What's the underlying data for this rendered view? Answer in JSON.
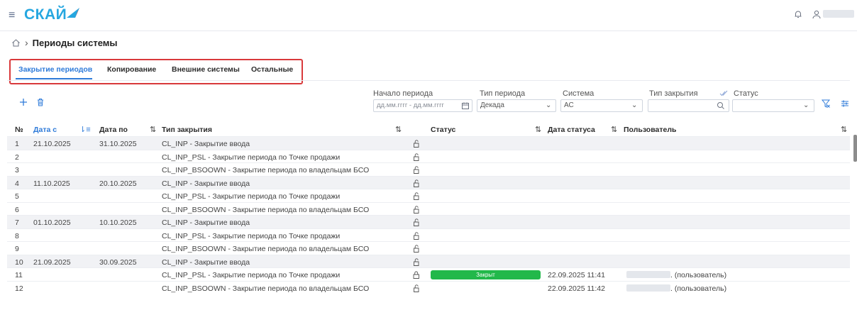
{
  "app": {
    "logo_text": "СКАЙ"
  },
  "breadcrumb": {
    "title": "Периоды системы"
  },
  "tabs": [
    {
      "label": "Закрытие периодов"
    },
    {
      "label": "Копирование"
    },
    {
      "label": "Внешние системы"
    },
    {
      "label": "Остальные"
    }
  ],
  "filters": {
    "period_start": {
      "label": "Начало периода",
      "placeholder": "дд.мм.гггг - дд.мм.гггг"
    },
    "period_type": {
      "label": "Тип периода",
      "value": "Декада"
    },
    "system": {
      "label": "Система",
      "value": "АС"
    },
    "closing_type": {
      "label": "Тип закрытия",
      "value": ""
    },
    "status": {
      "label": "Статус",
      "value": ""
    }
  },
  "table": {
    "columns": {
      "num": "№",
      "date_from": "Дата с",
      "date_to": "Дата по",
      "closing_type": "Тип закрытия",
      "status": "Статус",
      "status_date": "Дата статуса",
      "user": "Пользователь"
    },
    "rows": [
      {
        "num": "1",
        "date_from": "21.10.2025",
        "date_to": "31.10.2025",
        "type": "CL_INP - Закрытие ввода",
        "status": "",
        "status_date": "",
        "user": ""
      },
      {
        "num": "2",
        "date_from": "",
        "date_to": "",
        "type": "CL_INP_PSL - Закрытие периода по Точке продажи",
        "status": "",
        "status_date": "",
        "user": ""
      },
      {
        "num": "3",
        "date_from": "",
        "date_to": "",
        "type": "CL_INP_BSOOWN - Закрытие периода по владельцам БСО",
        "status": "",
        "status_date": "",
        "user": ""
      },
      {
        "num": "4",
        "date_from": "11.10.2025",
        "date_to": "20.10.2025",
        "type": "CL_INP - Закрытие ввода",
        "status": "",
        "status_date": "",
        "user": ""
      },
      {
        "num": "5",
        "date_from": "",
        "date_to": "",
        "type": "CL_INP_PSL - Закрытие периода по Точке продажи",
        "status": "",
        "status_date": "",
        "user": ""
      },
      {
        "num": "6",
        "date_from": "",
        "date_to": "",
        "type": "CL_INP_BSOOWN - Закрытие периода по владельцам БСО",
        "status": "",
        "status_date": "",
        "user": ""
      },
      {
        "num": "7",
        "date_from": "01.10.2025",
        "date_to": "10.10.2025",
        "type": "CL_INP - Закрытие ввода",
        "status": "",
        "status_date": "",
        "user": ""
      },
      {
        "num": "8",
        "date_from": "",
        "date_to": "",
        "type": "CL_INP_PSL - Закрытие периода по Точке продажи",
        "status": "",
        "status_date": "",
        "user": ""
      },
      {
        "num": "9",
        "date_from": "",
        "date_to": "",
        "type": "CL_INP_BSOOWN - Закрытие периода по владельцам БСО",
        "status": "",
        "status_date": "",
        "user": ""
      },
      {
        "num": "10",
        "date_from": "21.09.2025",
        "date_to": "30.09.2025",
        "type": "CL_INP - Закрытие ввода",
        "status": "",
        "status_date": "",
        "user": ""
      },
      {
        "num": "11",
        "date_from": "",
        "date_to": "",
        "type": "CL_INP_PSL - Закрытие периода по Точке продажи",
        "status": "Закрыт",
        "status_date": "22.09.2025 11:41",
        "user": ". (пользователь)"
      },
      {
        "num": "12",
        "date_from": "",
        "date_to": "",
        "type": "CL_INP_BSOOWN - Закрытие периода по владельцам БСО",
        "status": "",
        "status_date": "22.09.2025 11:42",
        "user": ". (пользователь)"
      }
    ]
  },
  "icons": {
    "menu": "hamburger-icon",
    "notifications": "bell-icon",
    "account": "user-icon",
    "add": "plus-icon",
    "delete": "trash-icon",
    "calendar": "calendar-icon",
    "search": "search-icon",
    "filter_clear": "filter-clear-icon",
    "settings": "sliders-icon",
    "lock_open": "unlock-icon",
    "lock_closed": "lock-icon"
  },
  "colors": {
    "brand": "#26a7e0",
    "accent": "#2f7bd9",
    "status_closed": "#22b84a",
    "highlight_border": "#d9393b"
  }
}
